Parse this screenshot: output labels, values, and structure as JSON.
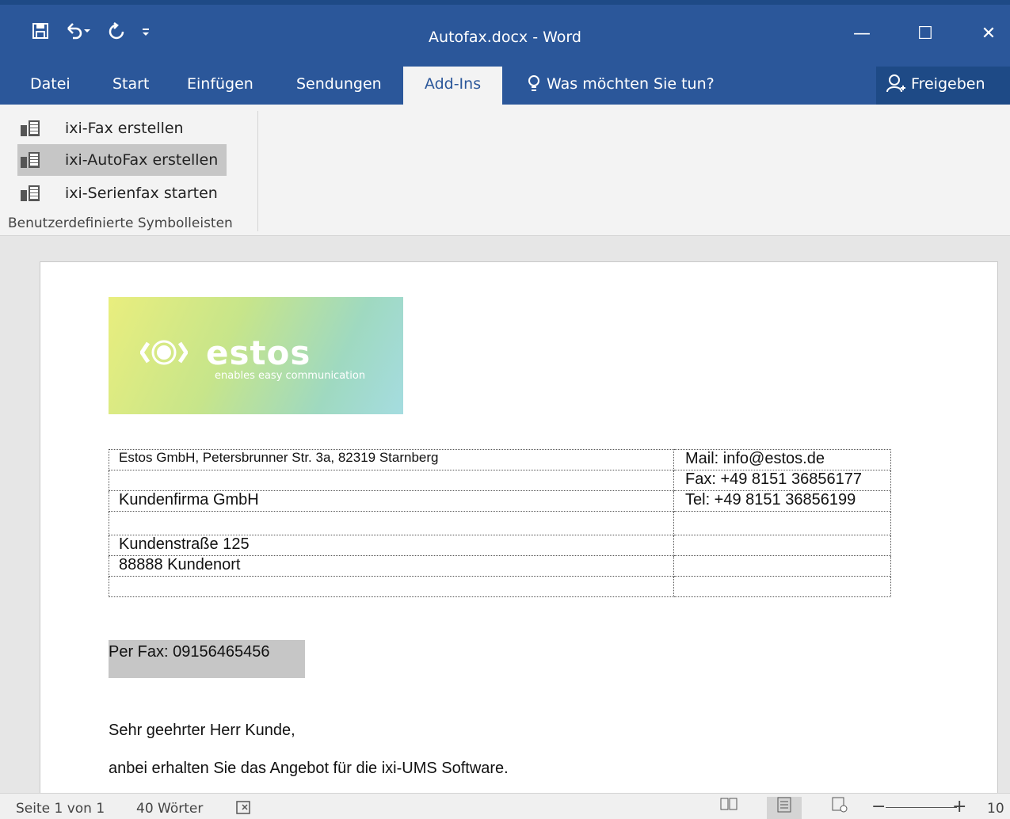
{
  "window": {
    "title": "Autofax.docx  -  Word",
    "qat": {
      "save_icon": "save-icon",
      "undo_icon": "undo-icon",
      "redo_icon": "redo-icon",
      "customize_icon": "customize-qat-icon"
    },
    "controls": {
      "minimize": "—",
      "maximize": "☐",
      "close": "✕"
    }
  },
  "tabs": [
    {
      "label": "Datei"
    },
    {
      "label": "Start"
    },
    {
      "label": "Einfügen"
    },
    {
      "label": "Sendungen"
    },
    {
      "label": "Add-Ins",
      "active": true
    }
  ],
  "tell_me": "Was möchten Sie tun?",
  "share": "Freigeben",
  "ribbon": {
    "buttons": [
      {
        "label": "ixi-Fax erstellen"
      },
      {
        "label": "ixi-AutoFax erstellen",
        "selected": true
      },
      {
        "label": "ixi-Serienfax starten"
      }
    ],
    "group_label": "Benutzerdefinierte Symbolleisten"
  },
  "document": {
    "logo": {
      "word": "estos",
      "tagline": "enables easy communication"
    },
    "address_table": {
      "sender_line": "Estos GmbH, Petersbrunner Str. 3a, 82319 Starnberg",
      "mail": "Mail: info@estos.de",
      "fax": "Fax: +49 8151 36856177",
      "tel": "Tel: +49 8151 36856199",
      "recipient_company": "Kundenfirma GmbH",
      "street": "Kundenstraße 125",
      "city": "88888 Kundenort"
    },
    "fax_line": "Per Fax: 09156465456",
    "salutation": "Sehr geehrter Herr  Kunde,",
    "body": "anbei erhalten Sie das Angebot für die ixi-UMS Software."
  },
  "status": {
    "page": "Seite 1 von 1",
    "words": "40 Wörter",
    "zoom": "10"
  },
  "colors": {
    "accent": "#2b579a",
    "ribbon": "#f3f3f3",
    "selection": "#c6c6c6"
  }
}
